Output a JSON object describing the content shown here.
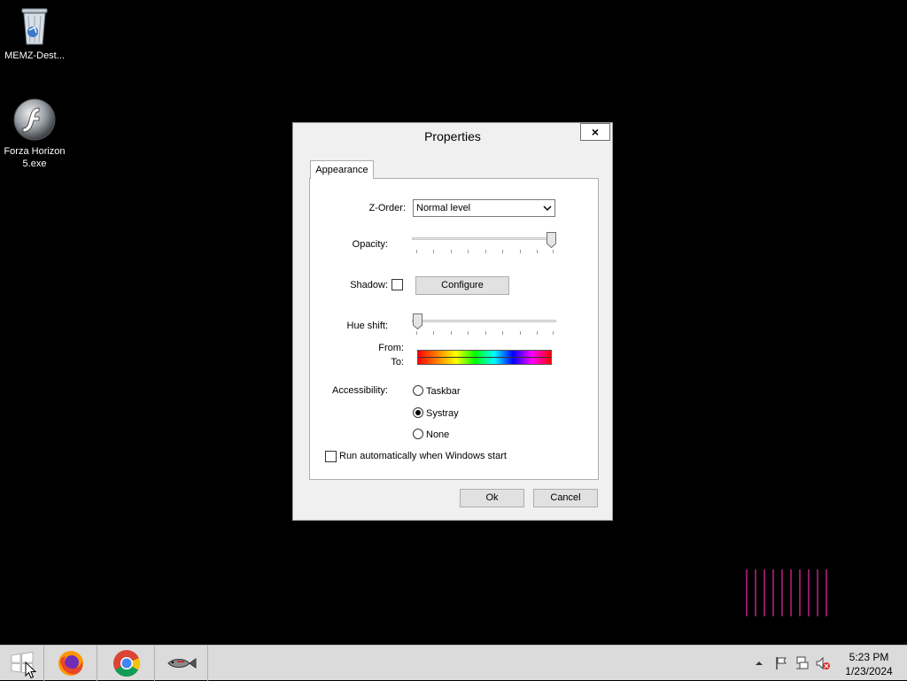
{
  "desktop": {
    "icons": [
      {
        "label": "MEMZ-Dest...",
        "icon": "recycle-bin-icon"
      },
      {
        "label": "Forza Horizon\n5.exe",
        "icon": "flash-player-icon"
      }
    ]
  },
  "dialog": {
    "title": "Properties",
    "close_label": "×",
    "tab": "Appearance",
    "zorder": {
      "label": "Z-Order:",
      "value": "Normal level"
    },
    "opacity": {
      "label": "Opacity:",
      "value_fraction": 1.0
    },
    "shadow": {
      "label": "Shadow:",
      "checked": false,
      "configure_label": "Configure"
    },
    "hue_shift": {
      "label": "Hue shift:",
      "value_fraction": 0.0
    },
    "from_label": "From:",
    "to_label": "To:",
    "accessibility": {
      "label": "Accessibility:",
      "options": [
        {
          "label": "Taskbar",
          "selected": false
        },
        {
          "label": "Systray",
          "selected": true
        },
        {
          "label": "None",
          "selected": false
        }
      ]
    },
    "autorun": {
      "label": "Run automatically when Windows start",
      "checked": false
    },
    "ok_label": "Ok",
    "cancel_label": "Cancel"
  },
  "taskbar": {
    "start_icon": "windows-logo-icon",
    "apps": [
      {
        "name": "firefox",
        "icon": "firefox-icon"
      },
      {
        "name": "chrome",
        "icon": "chrome-icon"
      },
      {
        "name": "fish-app",
        "icon": "fish-icon"
      }
    ],
    "tray_icons": [
      "show-hidden-icons-arrow",
      "action-center-flag-icon",
      "network-icon",
      "volume-muted-icon"
    ],
    "clock": {
      "time": "5:23 PM",
      "date": "1/23/2024"
    }
  },
  "colors": {
    "desktop_bg": "#000000",
    "taskbar_bg": "#dbdbdb",
    "glitch_lines": "#c0208a"
  }
}
